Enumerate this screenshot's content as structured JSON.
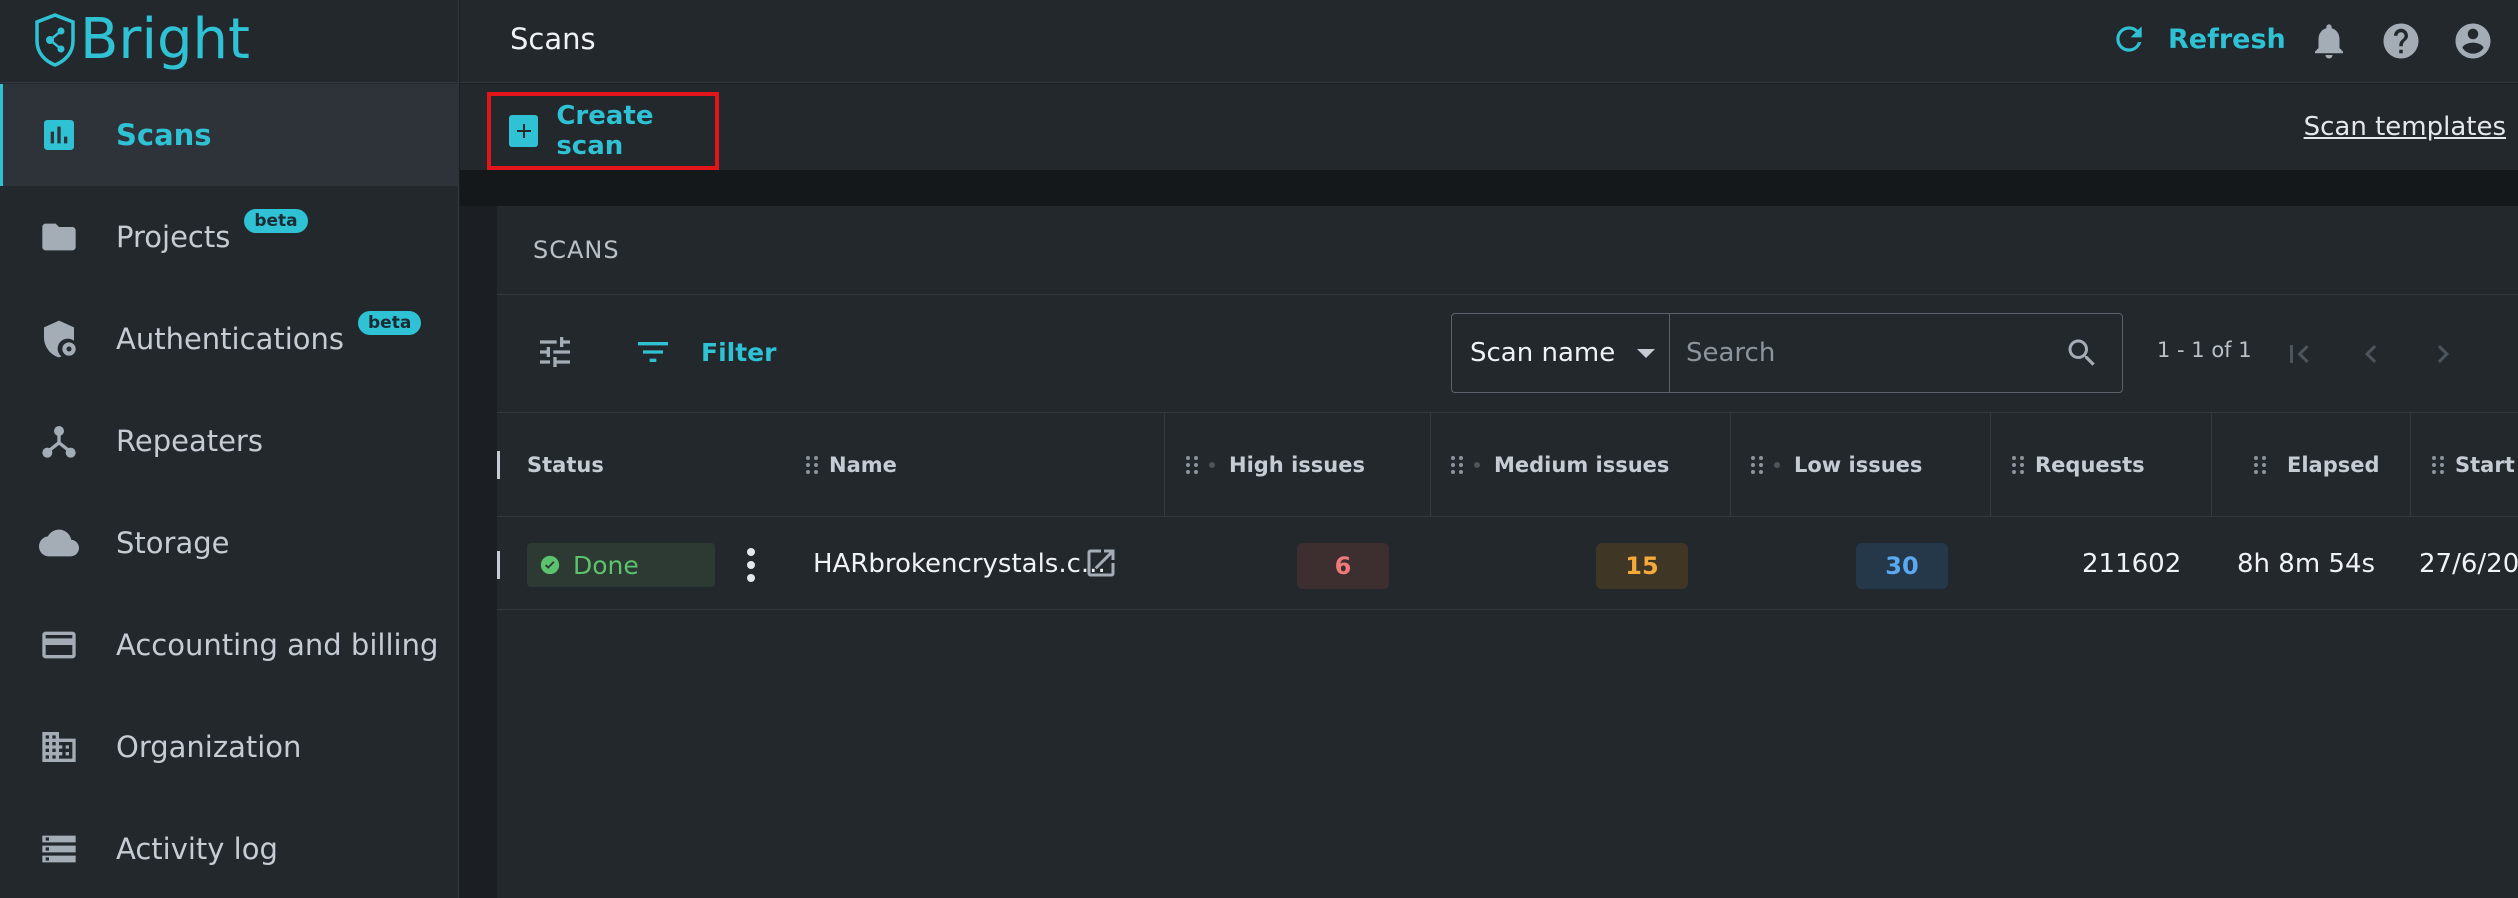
{
  "app": {
    "name": "Bright"
  },
  "sidebar": {
    "items": [
      {
        "label": "Scans",
        "icon": "bar-chart-icon",
        "active": true
      },
      {
        "label": "Projects",
        "icon": "folder-icon",
        "badge": "beta"
      },
      {
        "label": "Authentications",
        "icon": "shield-lock-icon",
        "badge": "beta"
      },
      {
        "label": "Repeaters",
        "icon": "network-icon"
      },
      {
        "label": "Storage",
        "icon": "cloud-icon"
      },
      {
        "label": "Accounting and billing",
        "icon": "credit-card-icon"
      },
      {
        "label": "Organization",
        "icon": "building-icon"
      },
      {
        "label": "Activity log",
        "icon": "list-icon"
      }
    ]
  },
  "header": {
    "title": "Scans",
    "refresh_label": "Refresh",
    "accent_color": "#2fc2d4"
  },
  "actions": {
    "create_label": "Create scan",
    "templates_label": "Scan templates"
  },
  "card": {
    "title": "SCANS",
    "filter_label": "Filter",
    "search_field_selected": "Scan name",
    "search_placeholder": "Search",
    "pagination": "1 - 1 of 1"
  },
  "table": {
    "columns": [
      "Status",
      "Name",
      "High issues",
      "Medium issues",
      "Low issues",
      "Requests",
      "Elapsed",
      "Start t"
    ],
    "rows": [
      {
        "status": "Done",
        "name": "HARbrokencrystals.c...",
        "high": "6",
        "medium": "15",
        "low": "30",
        "requests": "211602",
        "elapsed": "8h 8m 54s",
        "start": "27/6/20"
      }
    ]
  },
  "colors": {
    "high_bg": "#3d2e30",
    "high_fg": "#f07a7a",
    "medium_bg": "#3f3626",
    "medium_fg": "#f5a93b",
    "low_bg": "#24384a",
    "low_fg": "#5aa8f0",
    "done": "#5cc26d"
  }
}
